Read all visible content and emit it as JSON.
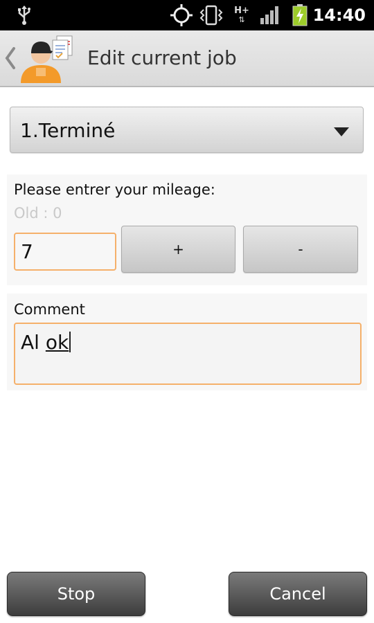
{
  "statusbar": {
    "time": "14:40",
    "icons": [
      "usb-icon",
      "gps-icon",
      "vibrate-icon",
      "network-hplus-icon",
      "signal-icon",
      "battery-charging-icon"
    ],
    "network_label": "H+"
  },
  "actionbar": {
    "title": "Edit current job"
  },
  "status_spinner": {
    "selected": "1.Terminé"
  },
  "mileage": {
    "prompt": "Please entrer your mileage:",
    "old": "Old : 0",
    "value": "7",
    "plus_label": "+",
    "minus_label": "-"
  },
  "comment": {
    "label": "Comment",
    "value_prefix": "Al ",
    "value_word": "ok"
  },
  "buttons": {
    "stop": "Stop",
    "cancel": "Cancel"
  },
  "colors": {
    "focus_border": "#f5b06a",
    "statusbar_bg": "#000000",
    "dark_button": "#4a4a4a"
  }
}
